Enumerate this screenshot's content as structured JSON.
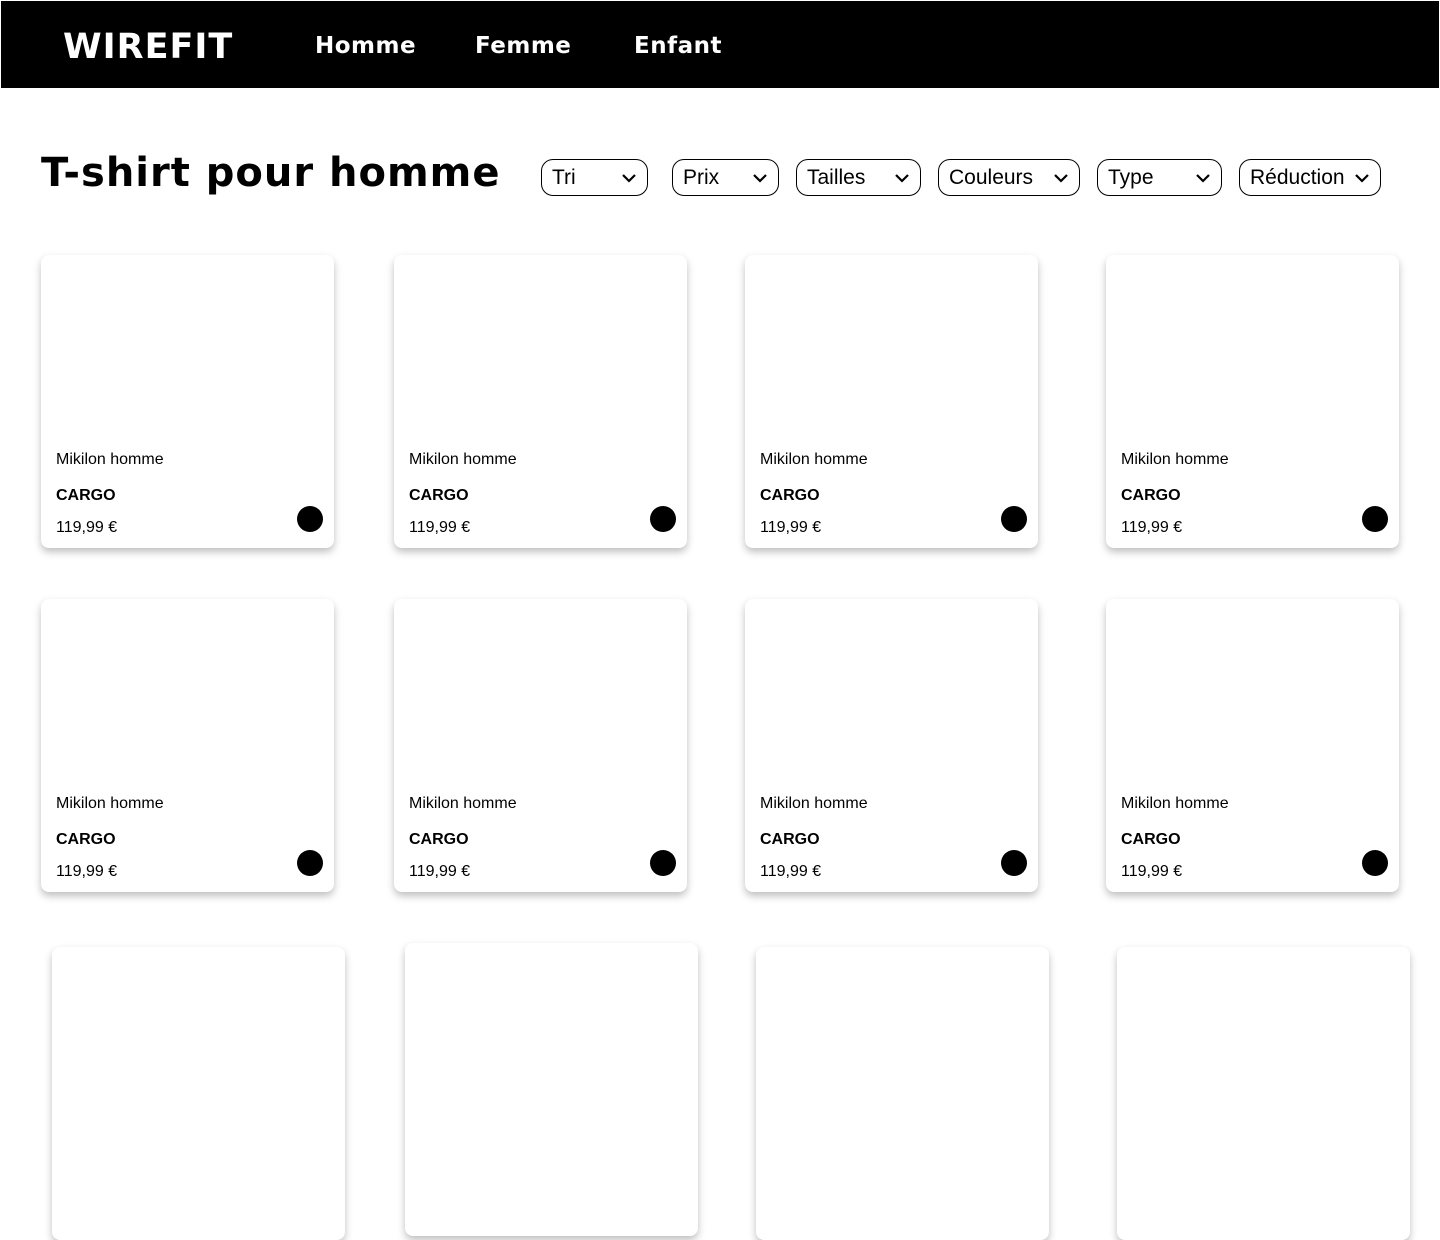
{
  "nav": {
    "logo": "WIREFIT",
    "links": [
      "Homme",
      "Femme",
      "Enfant"
    ]
  },
  "page_title": "T-shirt pour homme",
  "filters": [
    "Tri",
    "Prix",
    "Tailles",
    "Couleurs",
    "Type",
    "Réduction"
  ],
  "products": [
    {
      "name": "Mikilon homme",
      "brand": "CARGO",
      "price": "119,99 €"
    },
    {
      "name": "Mikilon homme",
      "brand": "CARGO",
      "price": "119,99 €"
    },
    {
      "name": "Mikilon homme",
      "brand": "CARGO",
      "price": "119,99 €"
    },
    {
      "name": "Mikilon homme",
      "brand": "CARGO",
      "price": "119,99 €"
    },
    {
      "name": "Mikilon homme",
      "brand": "CARGO",
      "price": "119,99 €"
    },
    {
      "name": "Mikilon homme",
      "brand": "CARGO",
      "price": "119,99 €"
    },
    {
      "name": "Mikilon homme",
      "brand": "CARGO",
      "price": "119,99 €"
    },
    {
      "name": "Mikilon homme",
      "brand": "CARGO",
      "price": "119,99 €"
    }
  ]
}
